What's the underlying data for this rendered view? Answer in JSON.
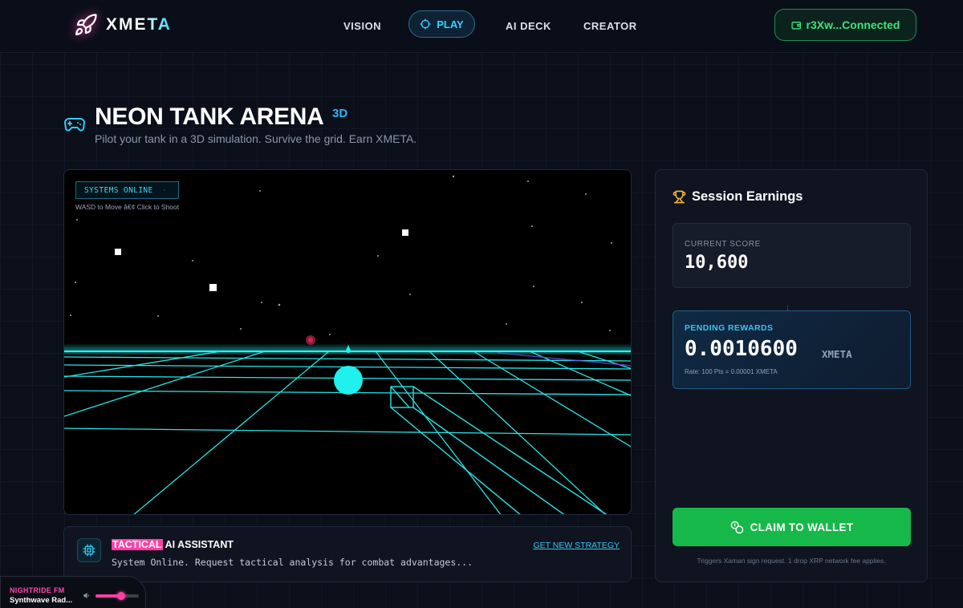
{
  "brand": {
    "name": "XMETA"
  },
  "nav": {
    "links": [
      {
        "label": "VISION"
      },
      {
        "label": "PLAY"
      },
      {
        "label": "AI DECK"
      },
      {
        "label": "CREATOR"
      }
    ],
    "active": "PLAY"
  },
  "wallet": {
    "label": "r3Xw...Connected"
  },
  "header": {
    "title": "NEON TANK ARENA",
    "badge": "3D",
    "subtitle": "Pilot your tank in a 3D simulation. Survive the grid. Earn XMETA."
  },
  "game": {
    "status": "SYSTEMS ONLINE",
    "controls_hint": "WASD to Move â€¢ Click to Shoot"
  },
  "assistant": {
    "title_highlight": "TACTICAL",
    "title_rest": " AI ASSISTANT",
    "action": "GET NEW STRATEGY",
    "message": "System Online. Request tactical analysis for combat advantages..."
  },
  "earnings": {
    "title": "Session Earnings",
    "score_label": "CURRENT SCORE",
    "score_value": "10,600",
    "rewards_label": "PENDING REWARDS",
    "rewards_value": "0.0010600",
    "rewards_unit": "XMETA",
    "rate": "Rate: 100 Pts = 0.00001 XMETA",
    "claim_label": "CLAIM TO WALLET",
    "claim_note": "Triggers Xaman sign request. 1 drop XRP network fee applies."
  },
  "radio": {
    "station": "NIGHTRIDE FM",
    "track": "Synthwave Rad...",
    "volume": 0.6
  },
  "colors": {
    "accent_cyan": "#35d3ff",
    "accent_pink": "#ff3fa6",
    "success_green": "#17b84a",
    "background": "#0b0f1a"
  },
  "icons": {
    "logo": "rocket-icon",
    "play": "crosshair-icon",
    "wallet": "wallet-icon",
    "title": "gamepad-icon",
    "earnings": "trophy-icon",
    "assistant": "cpu-chip-icon",
    "claim": "coins-icon",
    "volume": "speaker-icon"
  }
}
